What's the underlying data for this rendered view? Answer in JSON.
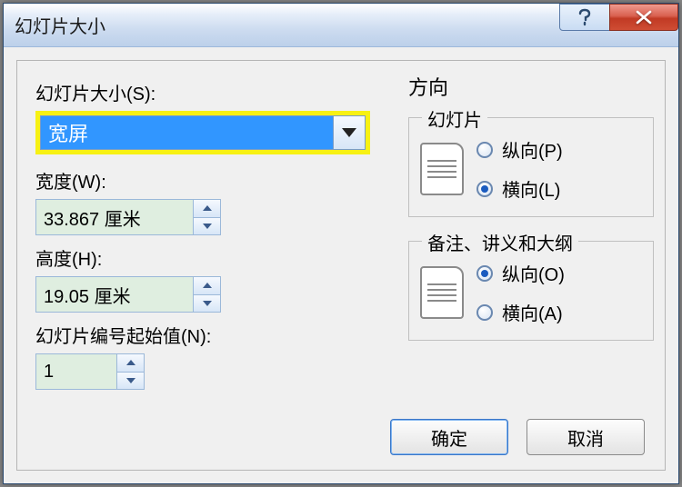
{
  "title": "幻灯片大小",
  "left": {
    "size_label": "幻灯片大小(S):",
    "size_value": "宽屏",
    "width_label": "宽度(W):",
    "width_value": "33.867 厘米",
    "height_label": "高度(H):",
    "height_value": "19.05 厘米",
    "startnum_label": "幻灯片编号起始值(N):",
    "startnum_value": "1"
  },
  "right": {
    "section": "方向",
    "slide_group": "幻灯片",
    "notes_group": "备注、讲义和大纲",
    "portrait_p": "纵向(P)",
    "landscape_l": "横向(L)",
    "portrait_o": "纵向(O)",
    "landscape_a": "横向(A)"
  },
  "footer": {
    "ok": "确定",
    "cancel": "取消"
  }
}
